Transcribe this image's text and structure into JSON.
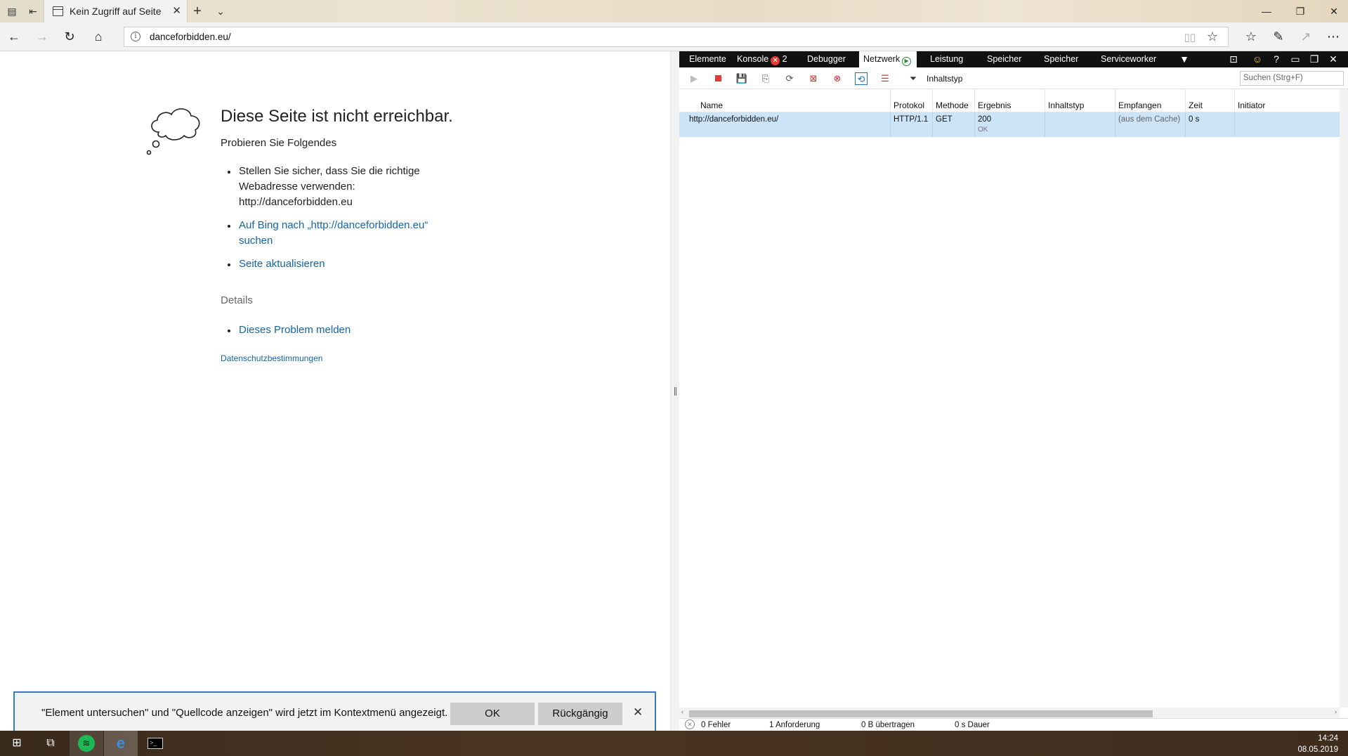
{
  "browser": {
    "tab_title": "Kein Zugriff auf Seite",
    "url": "danceforbidden.eu/"
  },
  "error_page": {
    "title": "Diese Seite ist nicht erreichbar.",
    "try_heading": "Probieren Sie Folgendes",
    "suggestions": [
      {
        "line1": "Stellen Sie sicher, dass Sie die richtige",
        "line2": "Webadresse verwenden:",
        "line3": "http://danceforbidden.eu"
      },
      {
        "line1": "Auf Bing nach „http://danceforbidden.eu“",
        "line2": "suchen"
      },
      {
        "line1": "Seite aktualisieren"
      }
    ],
    "details_label": "Details",
    "report_link": "Dieses Problem melden",
    "privacy_link": "Datenschutzbestimmungen"
  },
  "notification": {
    "message": "\"Element untersuchen\" und \"Quellcode anzeigen\" wird jetzt im Kontextmenü angezeigt.",
    "ok_label": "OK",
    "undo_label": "Rückgängig"
  },
  "devtools": {
    "tabs": [
      {
        "label": "Elemente"
      },
      {
        "label": "Konsole",
        "badge_count": "2"
      },
      {
        "label": "Debugger"
      },
      {
        "label": "Netzwerk"
      },
      {
        "label": "Leistung"
      },
      {
        "label": "Speicher"
      },
      {
        "label": "Speicher"
      },
      {
        "label": "Serviceworker"
      }
    ],
    "active_tab": "Netzwerk",
    "filter_label": "Inhaltstyp",
    "search_placeholder": "Suchen (Strg+F)",
    "columns": [
      "Name",
      "Protokol",
      "Methode",
      "Ergebnis",
      "Inhaltstyp",
      "Empfangen",
      "Zeit",
      "Initiator"
    ],
    "rows": [
      {
        "name": "http://danceforbidden.eu/",
        "protocol": "HTTP/1.1",
        "method": "GET",
        "status": "200",
        "status_text": "OK",
        "content_type": "",
        "received": "(aus dem Cache)",
        "time": "0 s",
        "initiator": ""
      }
    ],
    "status_bar": {
      "errors": "0 Fehler",
      "requests": "1 Anforderung",
      "transferred": "0 B übertragen",
      "duration": "0 s Dauer"
    }
  },
  "taskbar": {
    "time": "14:24",
    "date": "08.05.2019"
  },
  "colors": {
    "link": "#1565a8",
    "selected_row": "#cce4f7",
    "devtools_tabbar": "#111111",
    "notification_border": "#3a78c2",
    "error_badge": "#e53935",
    "record_stop": "#e53935"
  }
}
